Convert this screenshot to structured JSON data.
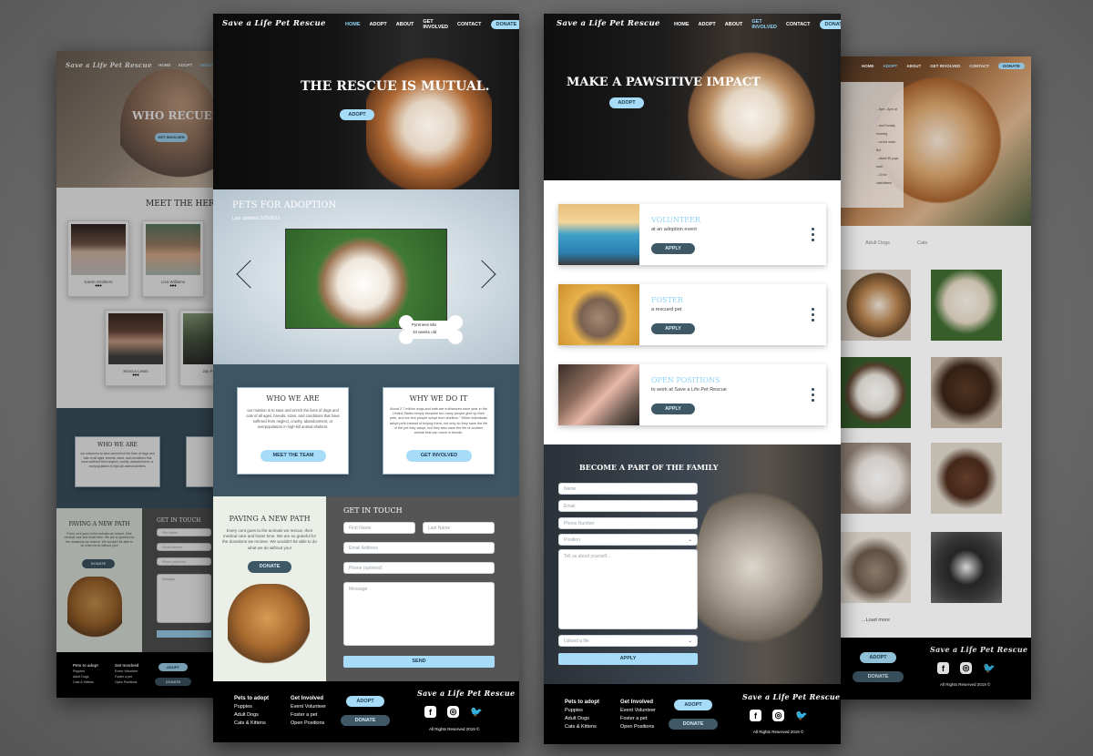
{
  "brand": "Save a Life Pet Rescue",
  "nav": {
    "home": "HOME",
    "adopt": "ADOPT",
    "about": "ABOUT",
    "get_involved": "GET INVOLVED",
    "contact": "CONTACT",
    "donate": "DONATE"
  },
  "about_page": {
    "hero_title": "WHO RECUES WHO?",
    "hero_cta": "GET INVOLVED",
    "heroes_heading": "MEET THE HEROES",
    "heroes": [
      {
        "name": "Karen Smithers"
      },
      {
        "name": "Lisa Williams"
      },
      {
        "name": "Monica Lewis"
      },
      {
        "name": "Jay Pa..."
      }
    ],
    "who_we_are": "WHO WE ARE",
    "who_text": "our mission is to save and enrich the lives of dogs and cats of all ages, breeds, sizes, and conditions that have suffered from neglect, cruelty, abandonment, or overpopulation in high-kill animal shelters.",
    "paving_title": "PAVING A NEW PATH",
    "paving_text": "Every cent goes to the animals we rescue, their medical care and foster time. We are so grateful for the donations we recieve. We wouldn't be able to do what we do without you!",
    "paving_cta": "DONATE",
    "contact_title": "GET IN TOUCH",
    "contact_placeholders": [
      "First Name",
      "Email Address",
      "Phone (optional)",
      "Message"
    ]
  },
  "home_page": {
    "hero_title": "THE RESCUE IS MUTUAL.",
    "hero_cta": "ADOPT",
    "pets_title": "PETS FOR ADOPTION",
    "pets_updated": "Last updated 2/25/2019",
    "pet_breed": "Pyrenees Mix",
    "pet_age": "10 weeks old",
    "who_title": "WHO WE ARE",
    "who_text": "our mission is to save and enrich the lives of dogs and cats of all ages, breeds, sizes, and conditions that have suffered from neglect, cruelty, abandonment, or overpopulation in high-kill animal shelters.",
    "who_cta": "MEET THE TEAM",
    "why_title": "WHY WE DO IT",
    "why_text": "About 2.7 million dogs and cats are euthanized each year in the United States simply because too many people give up their pets, and too few people adopt from shelters.\" When individuals adopt pets instead of buying them, not only do they save the life of the pet they adopt, but they also save the life of another animal that can move in beside.",
    "why_cta": "GET INVOLVED",
    "paving_title": "PAVING A NEW PATH",
    "paving_text": "Every cent goes to the animals we rescue, their medical care and foster time. We are so grateful for the donations we recieve. We wouldn't be able to do what we do without you!",
    "paving_cta": "DONATE",
    "contact_title": "GET IN TOUCH",
    "placeholders": {
      "first": "First Name",
      "last": "Last Name",
      "email": "Email Address",
      "phone": "Phone (optional)",
      "message": "Message"
    },
    "send": "SEND"
  },
  "involved_page": {
    "hero_title": "MAKE A PAWSITIVE IMPACT",
    "hero_cta": "ADOPT",
    "items": [
      {
        "title": "VOLUNTEER",
        "sub": "at an adoption event",
        "cta": "APPLY"
      },
      {
        "title": "FOSTER",
        "sub": "a rescued pet",
        "cta": "APPLY"
      },
      {
        "title": "OPEN POSITIONS",
        "sub": "to work at Save a Life Pet Rescue",
        "cta": "APPLY"
      }
    ],
    "family_title": "BECOME A PART OF THE FAMILY",
    "fields": [
      "Name",
      "Email",
      "Phone Number",
      "Position"
    ],
    "message_placeholder": "Tell us about yourself...",
    "upload": "Upload a file",
    "apply": "APPLY"
  },
  "adopt_page": {
    "tabs": [
      "Adult Dogs",
      "Cats"
    ],
    "load_more": "...Load more",
    "overlay_lines": [
      "...5pm - 8pm at ...",
      "...and Sunday morning",
      "...on the order. But",
      "...about 35 pups each",
      "...15 for cats/kittens"
    ]
  },
  "footer": {
    "col1_title": "Pets to adopt",
    "col1_items": [
      "Puppies",
      "Adult Dogs",
      "Cats & Kittens"
    ],
    "col2_title": "Get Involved",
    "col2_items": [
      "Event Volunteer",
      "Foster a pet",
      "Open Positions"
    ],
    "adopt": "ADOPT",
    "donate": "DONATE",
    "rights": "All Rights Reserved 2019 ©"
  }
}
